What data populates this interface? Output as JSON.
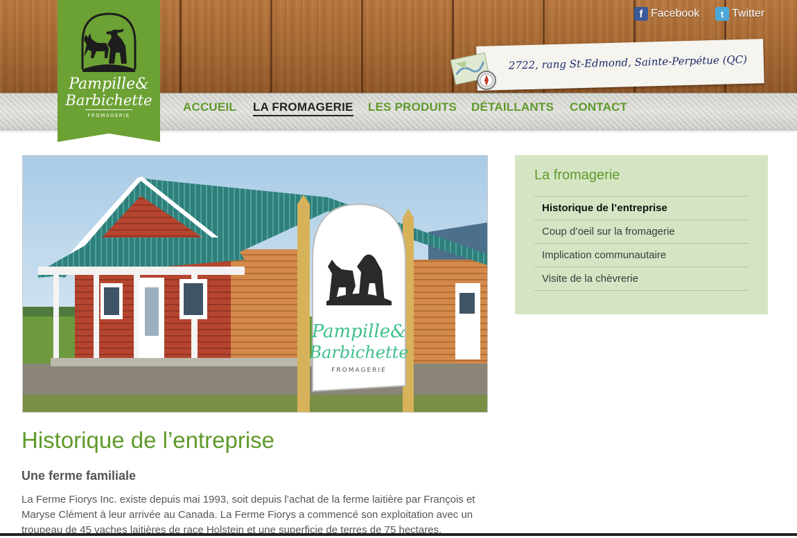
{
  "header": {
    "social": {
      "facebook_label": "Facebook",
      "twitter_label": "Twitter"
    },
    "address": "2722, rang St-Edmond, Sainte-Perpétue (QC)"
  },
  "nav": {
    "items": [
      {
        "label": "ACCUEIL",
        "active": false
      },
      {
        "label": "LA FROMAGERIE",
        "active": true
      },
      {
        "label": "LES PRODUITS",
        "active": false
      },
      {
        "label": "DÉTAILLANTS",
        "active": false
      },
      {
        "label": "CONTACT",
        "active": false
      }
    ]
  },
  "sidebar": {
    "title": "La fromagerie",
    "items": [
      {
        "label": "Historique de l’entreprise",
        "current": true
      },
      {
        "label": "Coup d’oeil sur la fromagerie",
        "current": false
      },
      {
        "label": "Implication communautaire",
        "current": false
      },
      {
        "label": "Visite de la chèvrerie",
        "current": false
      }
    ]
  },
  "content": {
    "title": "Historique de l’entreprise",
    "subtitle": "Une ferme familiale",
    "paragraph": "La Ferme Fiorys Inc. existe depuis mai 1993, soit depuis l’achat de la ferme laitière par François et Maryse Clément à leur arrivée au Canada. La Ferme Fiorys a commencé son exploitation avec un troupeau de 45 vaches laitières de race Holstein et une superficie de terres de 75 hectares."
  },
  "icons": {
    "facebook": "facebook-icon",
    "twitter": "twitter-icon",
    "map": "map-compass-icon"
  },
  "colors": {
    "brand_green": "#5f9a2b",
    "ribbon_green": "#6ca134",
    "sidebar_bg": "#d5e5c4"
  }
}
